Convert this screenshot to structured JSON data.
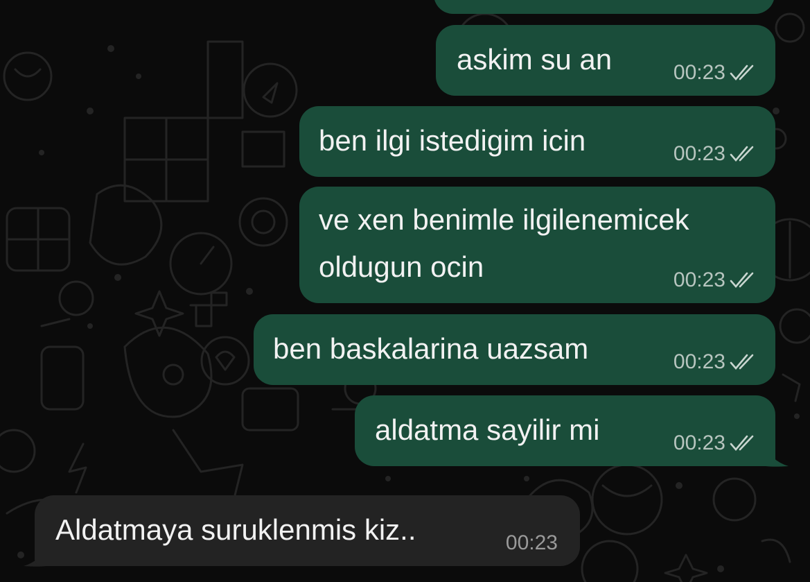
{
  "theme": {
    "outgoing_bubble": "#1a4d3a",
    "incoming_bubble": "#232323",
    "background": "#0b0b0b",
    "tick_color": "#c9d6d0"
  },
  "messages": [
    {
      "direction": "out",
      "lines": [
        "askim su an"
      ],
      "time": "00:23",
      "status": "read-double-check-icon"
    },
    {
      "direction": "out",
      "lines": [
        "ben ilgi istedigim icin"
      ],
      "time": "00:23",
      "status": "read-double-check-icon"
    },
    {
      "direction": "out",
      "lines": [
        "ve xen benimle ilgilenemicek",
        "oldugun ocin"
      ],
      "time": "00:23",
      "status": "read-double-check-icon"
    },
    {
      "direction": "out",
      "lines": [
        "ben baskalarina uazsam"
      ],
      "time": "00:23",
      "status": "read-double-check-icon"
    },
    {
      "direction": "out",
      "lines": [
        "aldatma sayilir mi"
      ],
      "time": "00:23",
      "status": "read-double-check-icon"
    },
    {
      "direction": "in",
      "lines": [
        "Aldatmaya suruklenmis kiz.."
      ],
      "time": "00:23"
    }
  ]
}
